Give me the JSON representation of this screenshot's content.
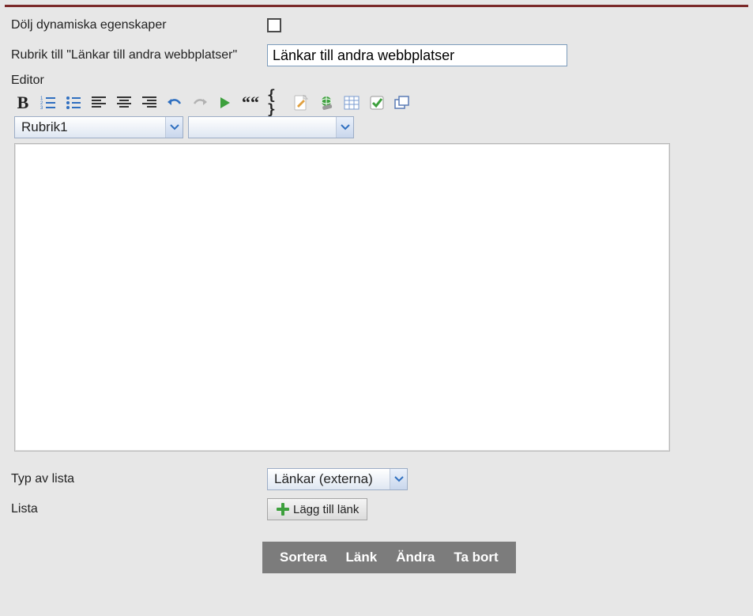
{
  "field_hide_dynamic": {
    "label": "Dölj dynamiska egenskaper"
  },
  "field_heading": {
    "label": "Rubrik till \"Länkar till andra webbplatser\"",
    "value": "Länkar till andra webbplatser"
  },
  "editor": {
    "label": "Editor",
    "heading_select": "Rubrik1",
    "style_select": ""
  },
  "toolbar": {
    "bold": "B",
    "quote": "““",
    "braces": "{ }"
  },
  "list_type": {
    "label": "Typ av lista",
    "value": "Länkar (externa)"
  },
  "list": {
    "label": "Lista",
    "add_label": "Lägg till länk"
  },
  "actions": {
    "sort": "Sortera",
    "link": "Länk",
    "edit": "Ändra",
    "delete": "Ta bort"
  },
  "colors": {
    "blue": "#2f6fc0",
    "green": "#3da03d",
    "orange": "#e08a2e"
  }
}
